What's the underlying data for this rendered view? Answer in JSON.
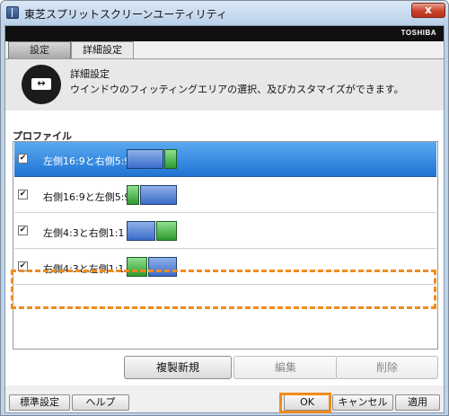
{
  "window": {
    "title": "東芝スプリットスクリーンユーティリティ",
    "close_glyph": "x",
    "brand": "TOSHIBA"
  },
  "tabs": [
    {
      "label": "設定",
      "active": false
    },
    {
      "label": "詳細設定",
      "active": true
    }
  ],
  "header": {
    "title": "詳細設定",
    "description": "ウインドウのフィッティングエリアの選択、及びカスタマイズができます。",
    "icon_glyph": "↔"
  },
  "profiles": {
    "label": "プロファイル",
    "items": [
      {
        "label": "左側16:9と右側5:9",
        "checked": true,
        "selected": true,
        "checkmark": "✔"
      },
      {
        "label": "右側16:9と左側5:9",
        "checked": true,
        "selected": false,
        "checkmark": "✔"
      },
      {
        "label": "左側4:3と右側1:1",
        "checked": true,
        "selected": false,
        "checkmark": "✔"
      },
      {
        "label": "右側4:3と左側1:1",
        "checked": true,
        "selected": false,
        "checkmark": "✔"
      }
    ]
  },
  "actions": {
    "duplicate_new": "複製新規",
    "edit": "編集",
    "delete": "削除"
  },
  "footer": {
    "default_settings": "標準設定",
    "help": "ヘルプ",
    "ok": "OK",
    "cancel": "キャンセル",
    "apply": "適用"
  },
  "colors": {
    "selection": "#2f86e0",
    "highlight": "#f08c1e",
    "preview_blue": "#3d6ccb",
    "preview_green": "#2f9a2f"
  }
}
